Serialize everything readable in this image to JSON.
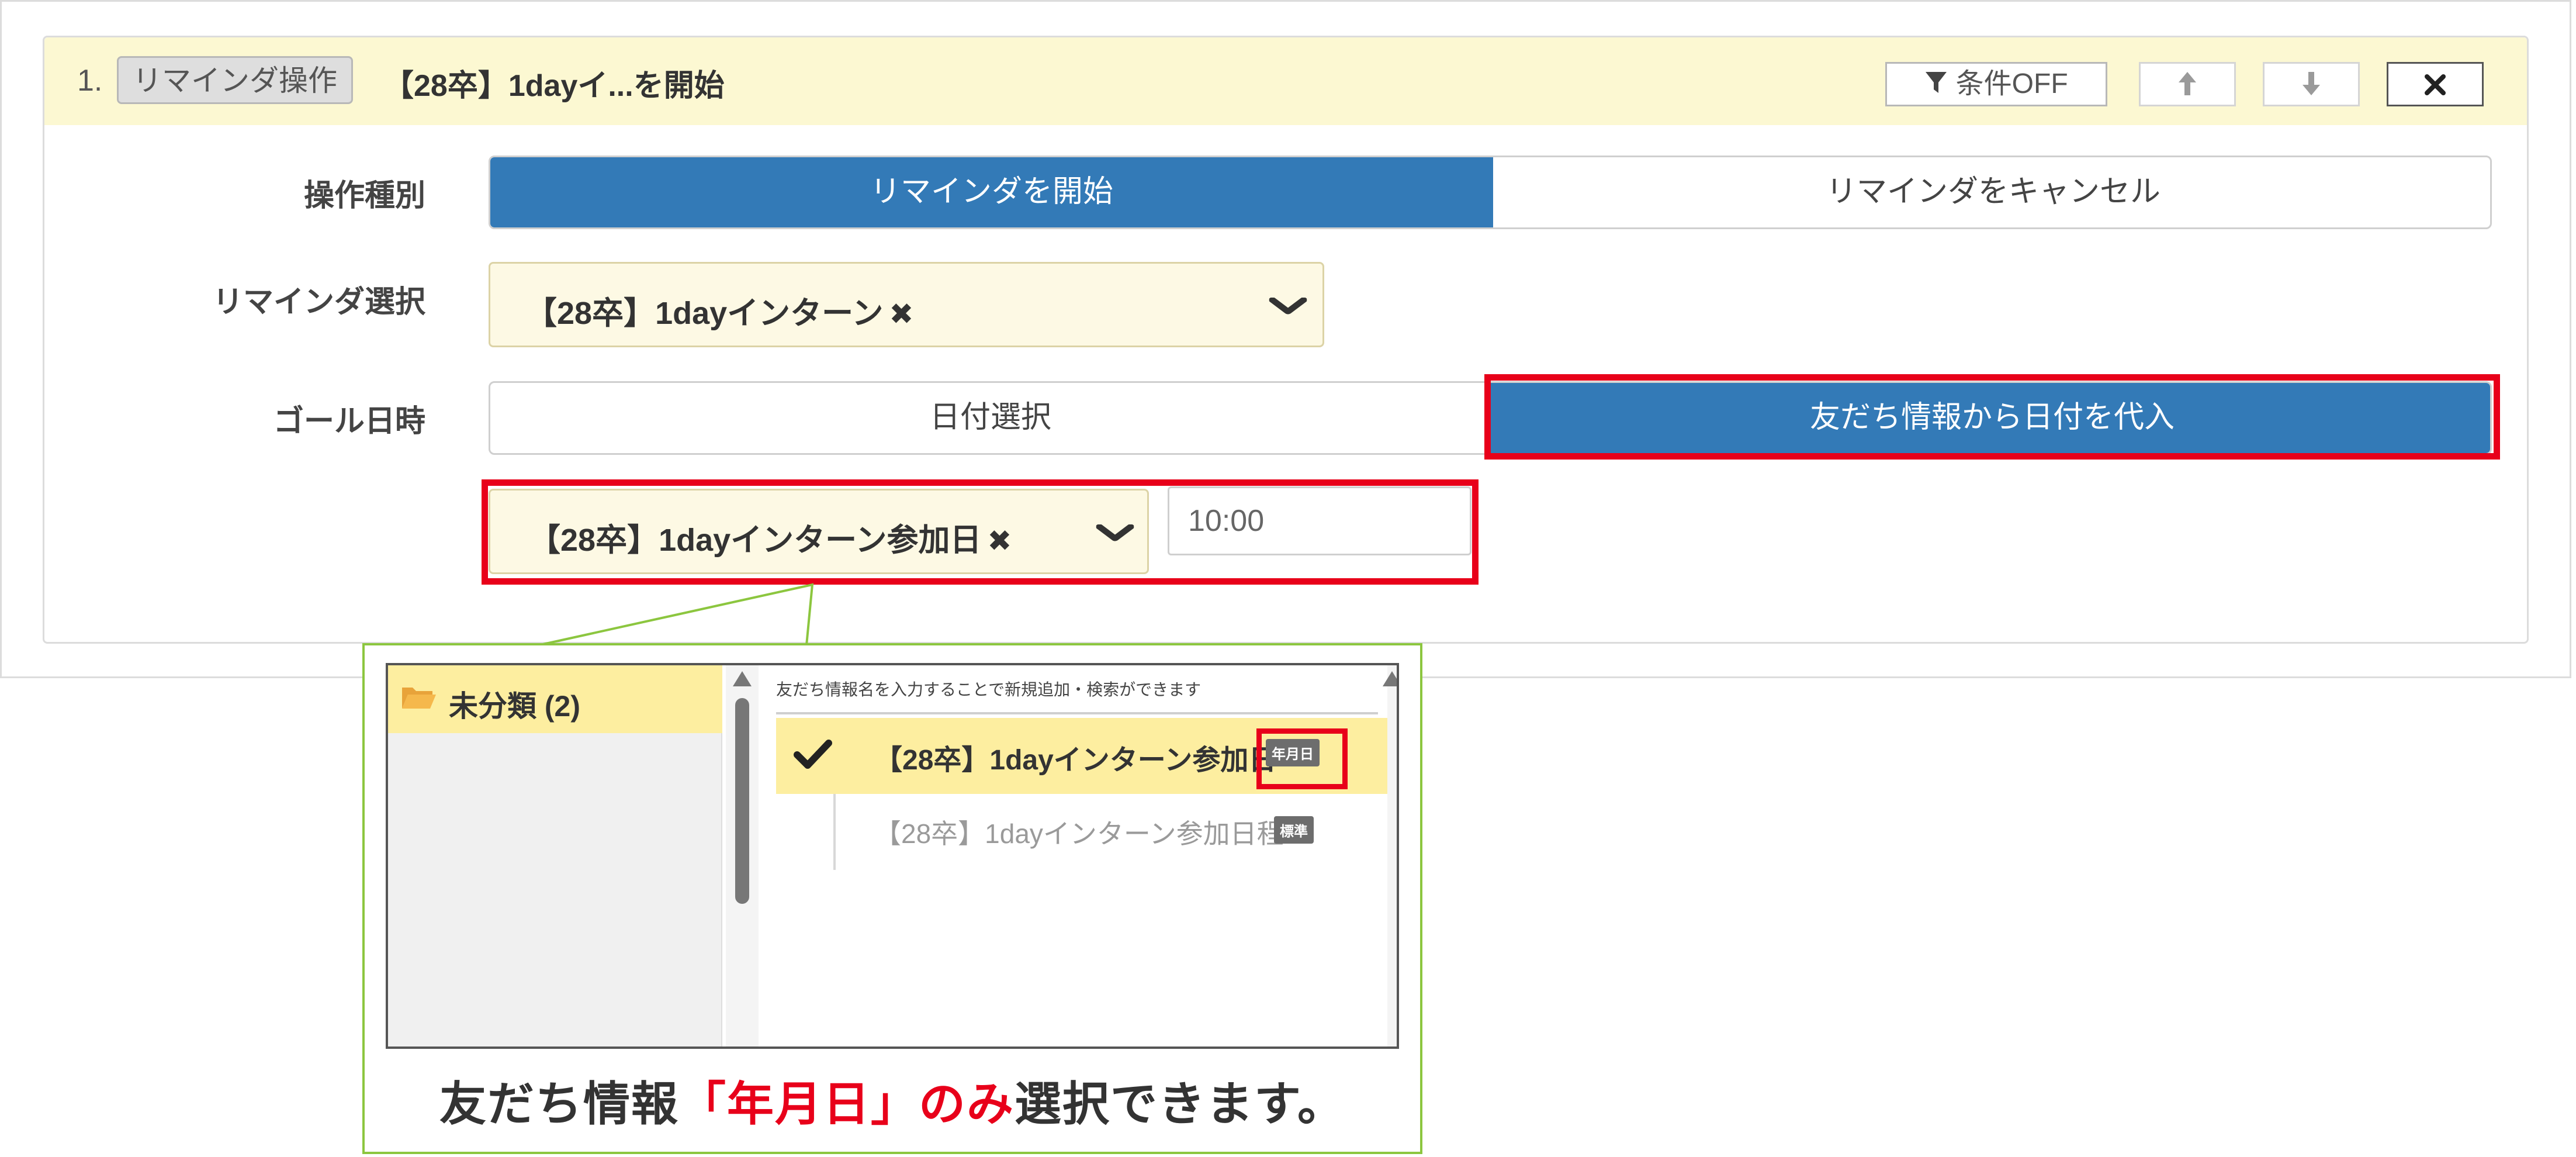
{
  "card": {
    "number": "1.",
    "badge": "リマインダ操作",
    "title": "【28卒】1dayイ...を開始",
    "buttons": {
      "condition_icon": "filter-icon",
      "condition_label": "条件OFF",
      "up_icon": "arrow-up-icon",
      "down_icon": "arrow-down-icon",
      "close_icon": "close-icon"
    }
  },
  "form": {
    "operation": {
      "label": "操作種別",
      "options": [
        "リマインダを開始",
        "リマインダをキャンセル"
      ],
      "selected": "リマインダを開始"
    },
    "reminder": {
      "label": "リマインダ選択",
      "value": "【28卒】1dayインターン",
      "remove": "✖"
    },
    "goal": {
      "label": "ゴール日時",
      "options": [
        "日付選択",
        "友だち情報から日付を代入"
      ],
      "selected": "友だち情報から日付を代入",
      "field_value": "【28卒】1dayインターン参加日",
      "field_remove": "✖",
      "time_placeholder": "10:00"
    }
  },
  "callout": {
    "folder": "未分類 (2)",
    "hint": "友だち情報名を入力することで新規追加・検索ができます",
    "items": [
      {
        "label": "【28卒】1dayインターン参加日",
        "tag": "年月日",
        "selected": true
      },
      {
        "label": "【28卒】1dayインターン参加日程",
        "tag": "標準",
        "selected": false
      }
    ],
    "note_before": "友だち情報",
    "note_highlight": "「年月日」のみ",
    "note_after": "選択できます。"
  },
  "colors": {
    "accent": "#337ab7",
    "header_bg": "#fcf8d2",
    "highlight": "#e8001a",
    "callout_border": "#8cc63f",
    "selected_row": "#fdeea0"
  }
}
